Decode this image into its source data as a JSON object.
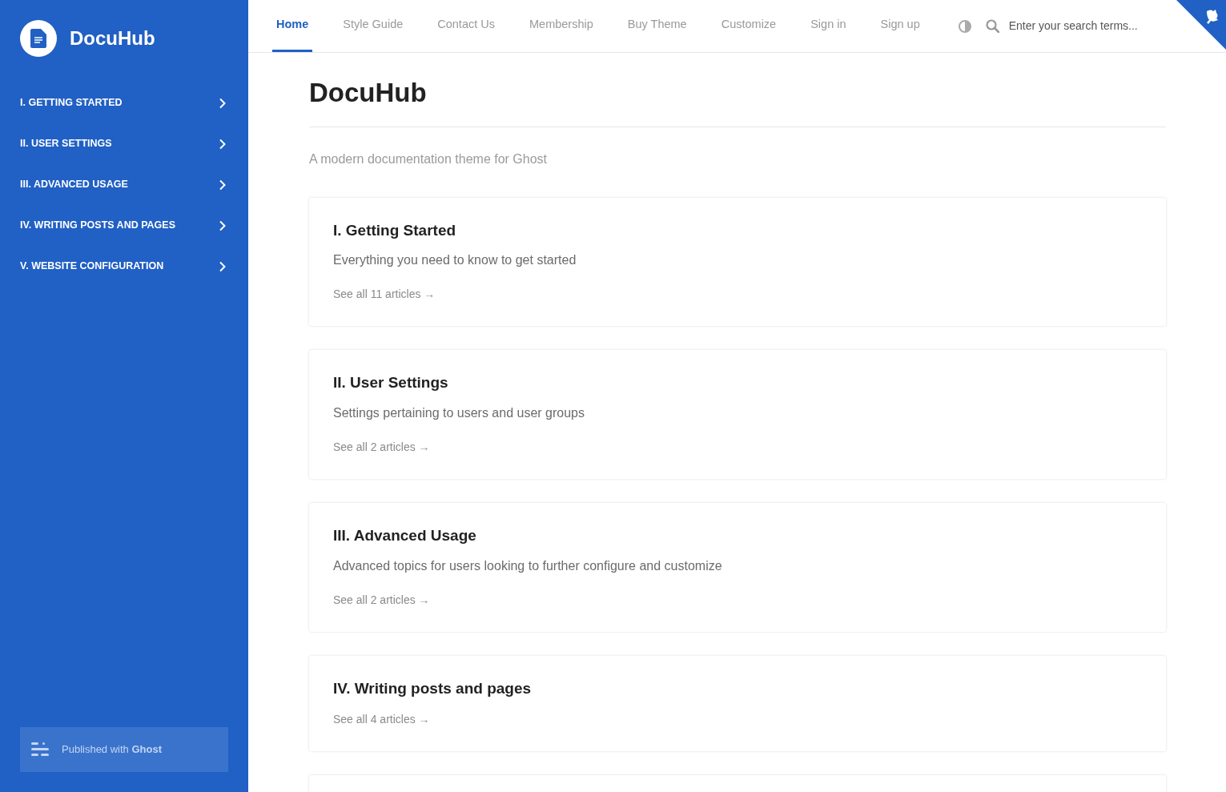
{
  "brand": {
    "name": "DocuHub"
  },
  "sidebar": {
    "items": [
      {
        "label": "I. GETTING STARTED",
        "expanded": false
      },
      {
        "label": "II. USER SETTINGS",
        "expanded": false
      },
      {
        "label": "III. ADVANCED USAGE",
        "expanded": false
      },
      {
        "label": "IV. WRITING POSTS AND PAGES",
        "expanded": false
      },
      {
        "label": "V. WEBSITE CONFIGURATION",
        "expanded": false
      }
    ],
    "footer": "Published with **Ghost**"
  },
  "nav": {
    "items": [
      {
        "label": "Home",
        "selected": true
      },
      {
        "label": "Style Guide",
        "selected": false
      },
      {
        "label": "Contact Us",
        "selected": false
      },
      {
        "label": "Membership",
        "selected": false
      },
      {
        "label": "Buy Theme",
        "selected": false
      },
      {
        "label": "Customize",
        "selected": false
      },
      {
        "label": "Sign in",
        "selected": false
      },
      {
        "label": "Sign up",
        "selected": false
      }
    ],
    "search": {
      "placeholder": "Enter your search terms..."
    }
  },
  "page": {
    "title": "DocuHub",
    "subtitle": "A modern documentation theme for Ghost"
  },
  "cards": [
    {
      "kind": "full",
      "title": "I. Getting Started",
      "description": "Everything you need to know to get started",
      "link": "See all 11 articles →"
    },
    {
      "kind": "full",
      "title": "II. User Settings",
      "description": "Settings pertaining to users and user groups",
      "link": "See all 2 articles →"
    },
    {
      "kind": "full",
      "title": "III. Advanced Usage",
      "description": "Advanced topics for users looking to further configure and customize",
      "link": "See all 2 articles →"
    },
    {
      "kind": "full",
      "title": "IV. Writing posts and pages",
      "link": "See all 4 articles →"
    },
    {
      "kind": "cut_off"
    }
  ]
}
